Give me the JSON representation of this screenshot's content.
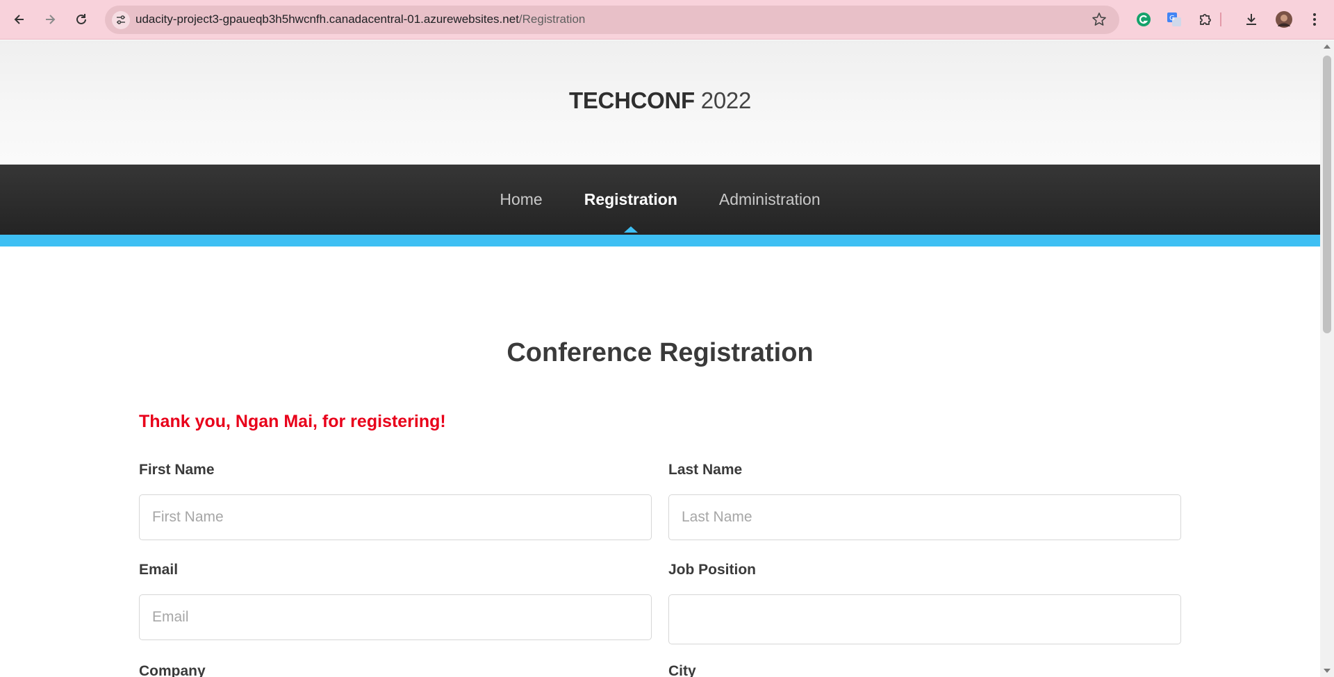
{
  "browser": {
    "url_host": "udacity-project3-gpaueqb3h5hwcnfh.canadacentral-01.azurewebsites.net",
    "url_path": "/Registration"
  },
  "site": {
    "brand_bold": "TECHCONF",
    "brand_year": "2022"
  },
  "nav": {
    "items": [
      {
        "label": "Home"
      },
      {
        "label": "Registration"
      },
      {
        "label": "Administration"
      }
    ]
  },
  "main": {
    "heading": "Conference Registration",
    "thanks": "Thank you, Ngan Mai, for registering!",
    "fields": [
      {
        "label": "First Name",
        "placeholder": "First Name"
      },
      {
        "label": "Last Name",
        "placeholder": "Last Name"
      },
      {
        "label": "Email",
        "placeholder": "Email"
      },
      {
        "label": "Job Position",
        "placeholder": ""
      },
      {
        "label": "Company"
      },
      {
        "label": "City"
      }
    ]
  },
  "colors": {
    "accent": "#3ebff3",
    "thanks": "#e8001a",
    "chrome": "#f8d2db"
  }
}
